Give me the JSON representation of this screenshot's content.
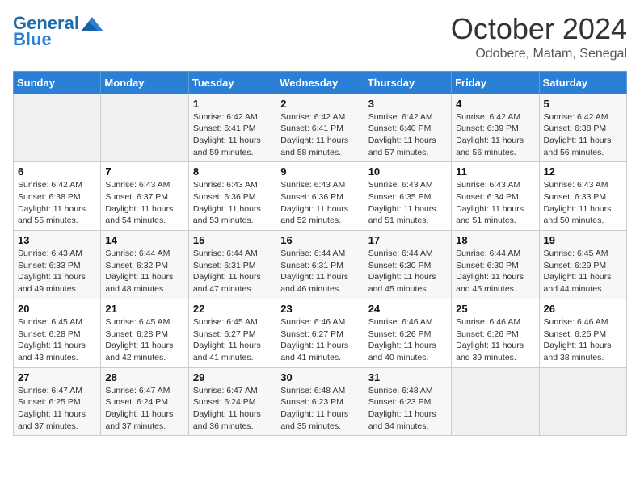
{
  "header": {
    "logo_line1": "General",
    "logo_line2": "Blue",
    "month_title": "October 2024",
    "location": "Odobere, Matam, Senegal"
  },
  "weekdays": [
    "Sunday",
    "Monday",
    "Tuesday",
    "Wednesday",
    "Thursday",
    "Friday",
    "Saturday"
  ],
  "weeks": [
    [
      {
        "day": "",
        "info": ""
      },
      {
        "day": "",
        "info": ""
      },
      {
        "day": "1",
        "info": "Sunrise: 6:42 AM\nSunset: 6:41 PM\nDaylight: 11 hours and 59 minutes."
      },
      {
        "day": "2",
        "info": "Sunrise: 6:42 AM\nSunset: 6:41 PM\nDaylight: 11 hours and 58 minutes."
      },
      {
        "day": "3",
        "info": "Sunrise: 6:42 AM\nSunset: 6:40 PM\nDaylight: 11 hours and 57 minutes."
      },
      {
        "day": "4",
        "info": "Sunrise: 6:42 AM\nSunset: 6:39 PM\nDaylight: 11 hours and 56 minutes."
      },
      {
        "day": "5",
        "info": "Sunrise: 6:42 AM\nSunset: 6:38 PM\nDaylight: 11 hours and 56 minutes."
      }
    ],
    [
      {
        "day": "6",
        "info": "Sunrise: 6:42 AM\nSunset: 6:38 PM\nDaylight: 11 hours and 55 minutes."
      },
      {
        "day": "7",
        "info": "Sunrise: 6:43 AM\nSunset: 6:37 PM\nDaylight: 11 hours and 54 minutes."
      },
      {
        "day": "8",
        "info": "Sunrise: 6:43 AM\nSunset: 6:36 PM\nDaylight: 11 hours and 53 minutes."
      },
      {
        "day": "9",
        "info": "Sunrise: 6:43 AM\nSunset: 6:36 PM\nDaylight: 11 hours and 52 minutes."
      },
      {
        "day": "10",
        "info": "Sunrise: 6:43 AM\nSunset: 6:35 PM\nDaylight: 11 hours and 51 minutes."
      },
      {
        "day": "11",
        "info": "Sunrise: 6:43 AM\nSunset: 6:34 PM\nDaylight: 11 hours and 51 minutes."
      },
      {
        "day": "12",
        "info": "Sunrise: 6:43 AM\nSunset: 6:33 PM\nDaylight: 11 hours and 50 minutes."
      }
    ],
    [
      {
        "day": "13",
        "info": "Sunrise: 6:43 AM\nSunset: 6:33 PM\nDaylight: 11 hours and 49 minutes."
      },
      {
        "day": "14",
        "info": "Sunrise: 6:44 AM\nSunset: 6:32 PM\nDaylight: 11 hours and 48 minutes."
      },
      {
        "day": "15",
        "info": "Sunrise: 6:44 AM\nSunset: 6:31 PM\nDaylight: 11 hours and 47 minutes."
      },
      {
        "day": "16",
        "info": "Sunrise: 6:44 AM\nSunset: 6:31 PM\nDaylight: 11 hours and 46 minutes."
      },
      {
        "day": "17",
        "info": "Sunrise: 6:44 AM\nSunset: 6:30 PM\nDaylight: 11 hours and 45 minutes."
      },
      {
        "day": "18",
        "info": "Sunrise: 6:44 AM\nSunset: 6:30 PM\nDaylight: 11 hours and 45 minutes."
      },
      {
        "day": "19",
        "info": "Sunrise: 6:45 AM\nSunset: 6:29 PM\nDaylight: 11 hours and 44 minutes."
      }
    ],
    [
      {
        "day": "20",
        "info": "Sunrise: 6:45 AM\nSunset: 6:28 PM\nDaylight: 11 hours and 43 minutes."
      },
      {
        "day": "21",
        "info": "Sunrise: 6:45 AM\nSunset: 6:28 PM\nDaylight: 11 hours and 42 minutes."
      },
      {
        "day": "22",
        "info": "Sunrise: 6:45 AM\nSunset: 6:27 PM\nDaylight: 11 hours and 41 minutes."
      },
      {
        "day": "23",
        "info": "Sunrise: 6:46 AM\nSunset: 6:27 PM\nDaylight: 11 hours and 41 minutes."
      },
      {
        "day": "24",
        "info": "Sunrise: 6:46 AM\nSunset: 6:26 PM\nDaylight: 11 hours and 40 minutes."
      },
      {
        "day": "25",
        "info": "Sunrise: 6:46 AM\nSunset: 6:26 PM\nDaylight: 11 hours and 39 minutes."
      },
      {
        "day": "26",
        "info": "Sunrise: 6:46 AM\nSunset: 6:25 PM\nDaylight: 11 hours and 38 minutes."
      }
    ],
    [
      {
        "day": "27",
        "info": "Sunrise: 6:47 AM\nSunset: 6:25 PM\nDaylight: 11 hours and 37 minutes."
      },
      {
        "day": "28",
        "info": "Sunrise: 6:47 AM\nSunset: 6:24 PM\nDaylight: 11 hours and 37 minutes."
      },
      {
        "day": "29",
        "info": "Sunrise: 6:47 AM\nSunset: 6:24 PM\nDaylight: 11 hours and 36 minutes."
      },
      {
        "day": "30",
        "info": "Sunrise: 6:48 AM\nSunset: 6:23 PM\nDaylight: 11 hours and 35 minutes."
      },
      {
        "day": "31",
        "info": "Sunrise: 6:48 AM\nSunset: 6:23 PM\nDaylight: 11 hours and 34 minutes."
      },
      {
        "day": "",
        "info": ""
      },
      {
        "day": "",
        "info": ""
      }
    ]
  ]
}
